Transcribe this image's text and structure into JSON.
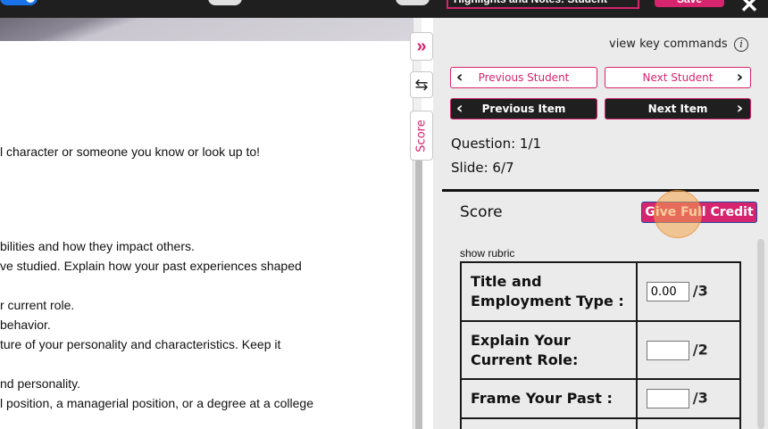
{
  "topbar": {
    "filter_text": "Highlights and Notes: Student",
    "save_label": "Save",
    "close_label": "✕"
  },
  "document": {
    "lines": [
      "l character or someone you know or look up to!",
      "bilities and how they impact others.",
      "ve studied. Explain how your past experiences shaped",
      "r current role.",
      " behavior.",
      "ture of your personality and characteristics. Keep it",
      "nd personality.",
      "l position, a managerial position, or a degree at a college"
    ]
  },
  "side_tabs": {
    "expand_glyph": "»",
    "swap_glyph": "⇆",
    "score_label": "Score"
  },
  "panel": {
    "view_key_label": "view key commands",
    "info_glyph": "i",
    "prev_student": "Previous Student",
    "next_student": "Next Student",
    "prev_item": "Previous Item",
    "next_item": "Next Item",
    "question": "Question: 1/1",
    "slide": "Slide: 6/7",
    "score_title": "Score",
    "full_credit_label": "Give Full Credit",
    "show_rubric_label": "show rubric"
  },
  "rubric": [
    {
      "criterion": "Title and Employment Type :",
      "value": "0.00",
      "max": "/3"
    },
    {
      "criterion": "Explain Your Current Role:",
      "value": "",
      "max": "/2"
    },
    {
      "criterion": "Frame Your Past :",
      "value": "",
      "max": "/3"
    },
    {
      "criterion": "",
      "value": "",
      "max": ""
    }
  ],
  "colors": {
    "accent": "#d6246e",
    "dark": "#1f1f1f",
    "panel_bg": "#ebebeb"
  }
}
